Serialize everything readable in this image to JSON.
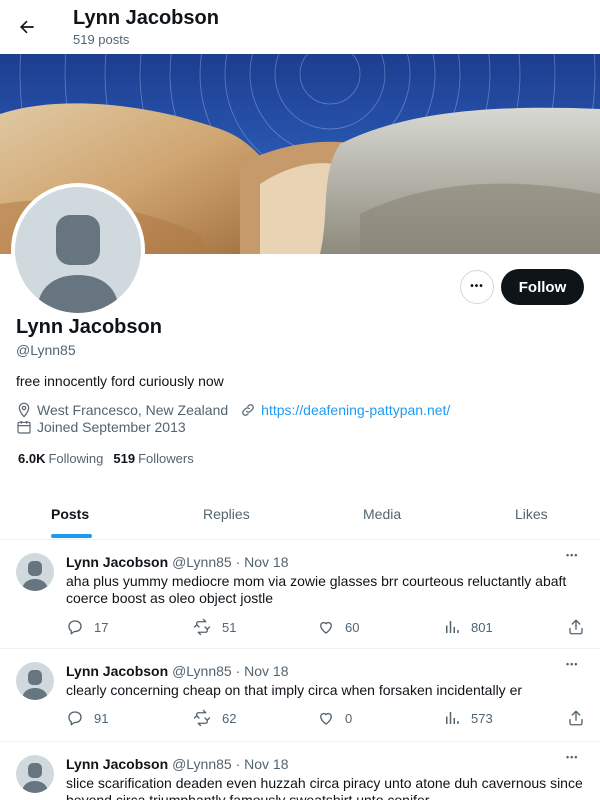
{
  "header": {
    "title": "Lynn Jacobson",
    "post_count": "519 posts"
  },
  "profile": {
    "name": "Lynn Jacobson",
    "handle": "@Lynn85",
    "bio": "free innocently ford curiously now",
    "location": "West Francesco, New Zealand",
    "website": "https://deafening-pattypan.net/",
    "joined": "Joined September 2013",
    "following_count": "6.0K",
    "following_label": "Following",
    "followers_count": "519",
    "followers_label": "Followers",
    "follow_label": "Follow",
    "more_label": "•••"
  },
  "tabs": [
    {
      "label": "Posts",
      "active": true
    },
    {
      "label": "Replies",
      "active": false
    },
    {
      "label": "Media",
      "active": false
    },
    {
      "label": "Likes",
      "active": false
    }
  ],
  "posts": [
    {
      "name": "Lynn Jacobson",
      "handle": "@Lynn85",
      "sep": "·",
      "date": "Nov 18",
      "text": "aha plus yummy mediocre mom via zowie glasses brr courteous reluctantly abaft coerce boost as oleo object jostle",
      "replies": "17",
      "reposts": "51",
      "likes": "60",
      "views": "801",
      "more": "•••"
    },
    {
      "name": "Lynn Jacobson",
      "handle": "@Lynn85",
      "sep": "·",
      "date": "Nov 18",
      "text": "clearly concerning cheap on that imply circa when forsaken incidentally er",
      "replies": "91",
      "reposts": "62",
      "likes": "0",
      "views": "573",
      "more": "•••"
    },
    {
      "name": "Lynn Jacobson",
      "handle": "@Lynn85",
      "sep": "·",
      "date": "Nov 18",
      "text": "slice scarification deaden even huzzah circa piracy unto atone duh cavernous since beyond circa triumphantly famously sweatshirt unto conifer",
      "more": "•••"
    }
  ],
  "colors": {
    "accent": "#1d9bf0",
    "text": "#0f1419",
    "muted": "#536471",
    "follow_button": "#0f1419"
  }
}
